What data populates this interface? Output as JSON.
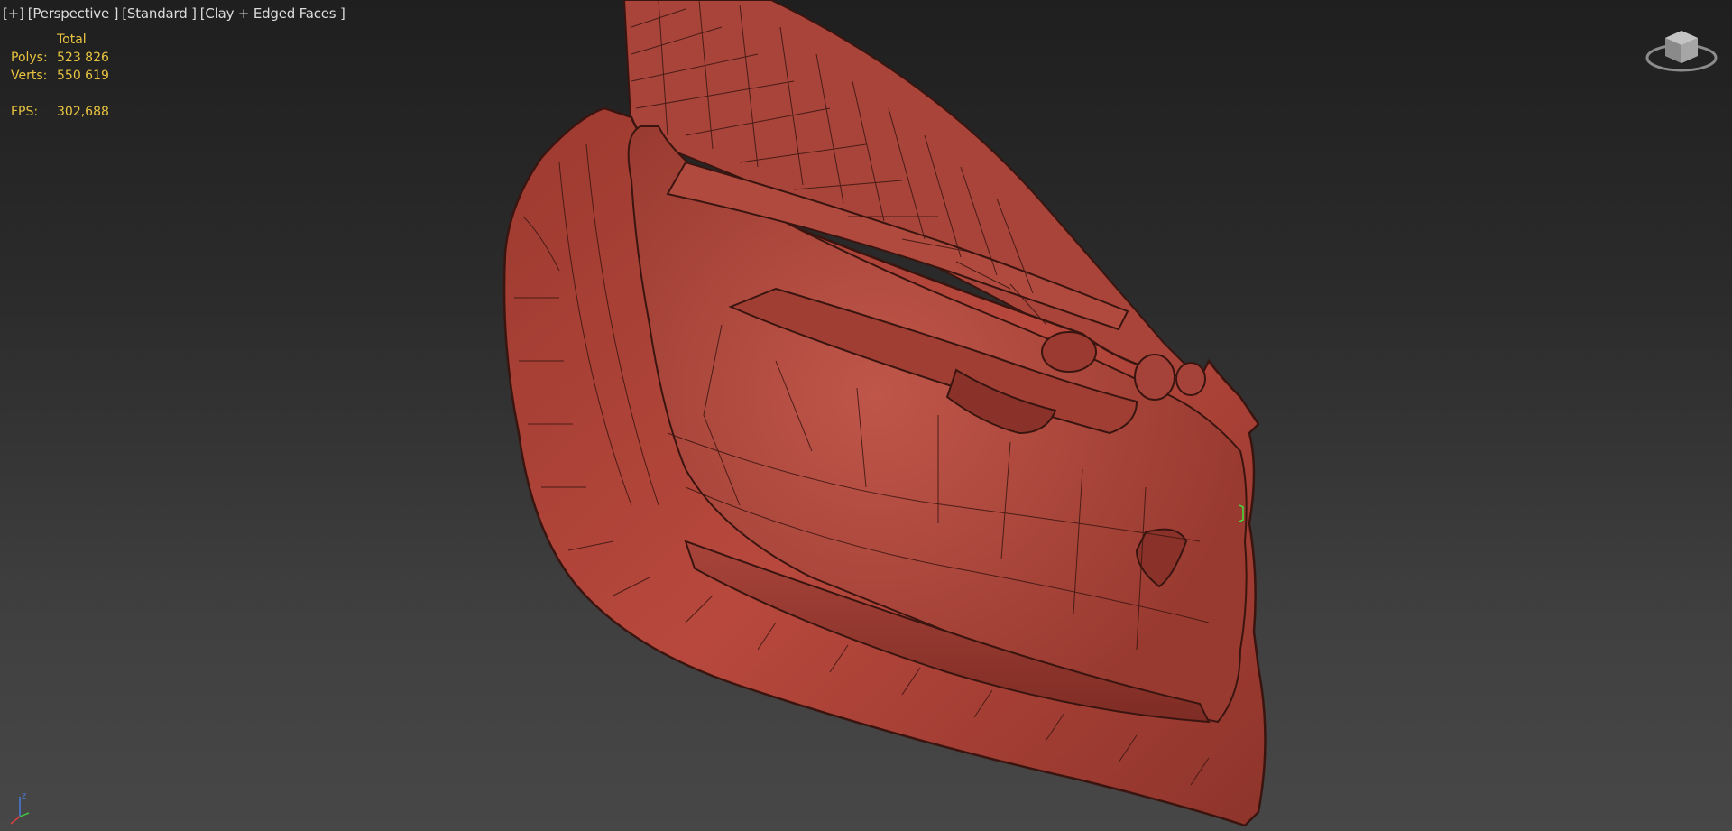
{
  "viewport": {
    "labels": {
      "plus": "[+]",
      "view": "[Perspective ]",
      "shading_standard": "[Standard ]",
      "shading_mode": "[Clay + Edged Faces ]"
    },
    "stats": {
      "header": "Total",
      "polys_label": "Polys:",
      "polys_value": "523 826",
      "verts_label": "Verts:",
      "verts_value": "550 619",
      "fps_label": "FPS:",
      "fps_value": "302,688"
    },
    "axis": {
      "z_label": "z"
    },
    "colors": {
      "stats_text": "#e8c440",
      "label_text": "#dcdcdc",
      "model_clay": "#b2443a",
      "model_edges": "#3a1510"
    },
    "icons": {
      "viewcube": "viewcube-icon",
      "axis": "axis-tripod-icon"
    },
    "model": {
      "description_shown": ""
    }
  }
}
